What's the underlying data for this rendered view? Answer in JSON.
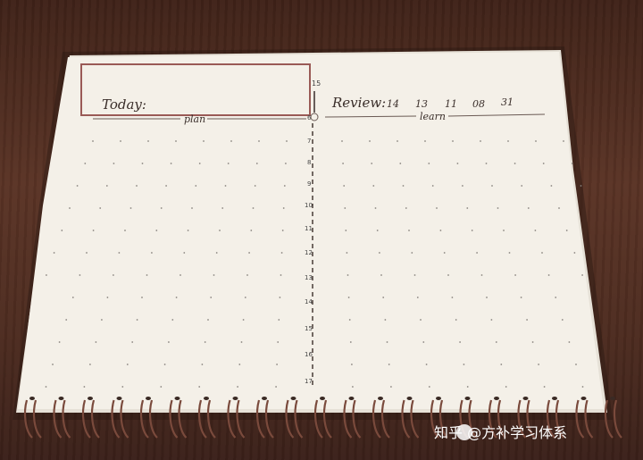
{
  "notebook": {
    "left_header": {
      "today_label": "Today:",
      "plan_label": "plan"
    },
    "right_header": {
      "review_label": "Review:",
      "review_numbers": [
        "14",
        "13",
        "11",
        "08",
        "31"
      ],
      "learn_label": "learn"
    },
    "timeline_hours": [
      "6",
      "7",
      "8",
      "9",
      "10",
      "11",
      "12",
      "13",
      "14",
      "15",
      "16",
      "17"
    ],
    "timeline_top_number": "15",
    "highlight_color": "#9a5a56",
    "ink_color": "#3a2e2a",
    "paper_color": "#f4f0e8",
    "spiral_color": "#7a4a3c"
  },
  "watermark": {
    "text": "知乎 @方补学习体系"
  }
}
